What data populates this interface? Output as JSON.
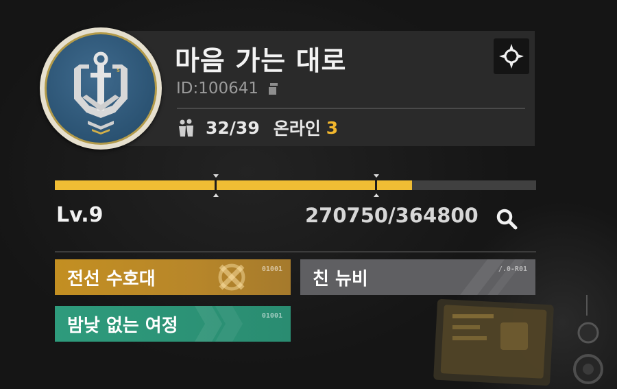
{
  "profile": {
    "name": "마음 가는 대로",
    "id_text": "ID:100641",
    "members": "32/39",
    "online_label": "온라인",
    "online_count": "3"
  },
  "progress": {
    "level": "Lv.9",
    "xp_text": "270750/364800",
    "current": 270750,
    "max": 364800
  },
  "badges": [
    {
      "label": "전선 수호대",
      "code": "01001",
      "color": "#c38f22"
    },
    {
      "label": "친 뉴비",
      "code": "/.0-R01",
      "color": "#5f5f62"
    },
    {
      "label": "밤낮 없는 여정",
      "code": "01001",
      "color": "#2e9b7c"
    }
  ],
  "colors": {
    "accent": "#f0bd34",
    "panel": "#2a2a2a",
    "background": "#151515"
  },
  "icons": {
    "emblem": "anchor-emblem-icon",
    "target": "crosshair-icon",
    "copy": "copy-icon",
    "members": "members-icon",
    "search": "search-icon"
  }
}
